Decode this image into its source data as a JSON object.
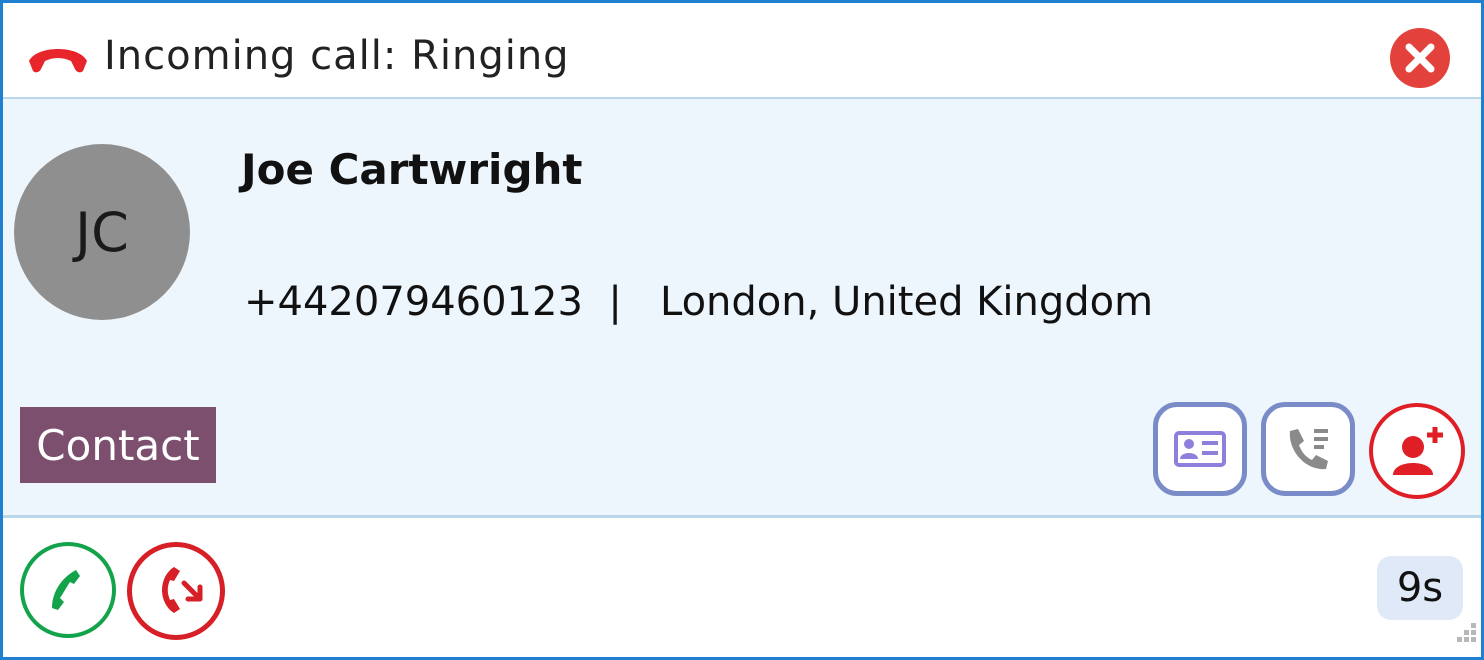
{
  "titlebar": {
    "status_text": "Incoming call: Ringing",
    "status_icon": "phone-hangup-icon",
    "close_icon": "close-icon",
    "colors": {
      "status_icon": "#e8252a",
      "close_button": "#e3413c"
    }
  },
  "caller": {
    "initials": "JC",
    "name": "Joe Cartwright",
    "phone": "+442079460123",
    "separator": "|",
    "location": "London, United Kingdom",
    "avatar_color": "#8f8f8f"
  },
  "contact_tag": {
    "label": "Contact",
    "color": "#7d4f6e"
  },
  "actions": [
    {
      "name": "contact-card-button",
      "icon": "contact-card-icon"
    },
    {
      "name": "call-history-button",
      "icon": "call-history-icon"
    },
    {
      "name": "add-contact-button",
      "icon": "add-contact-icon"
    }
  ],
  "footer": {
    "answer_icon": "phone-answer-icon",
    "reject_icon": "call-reject-icon",
    "timer": "9s",
    "colors": {
      "answer": "#13a34a",
      "reject": "#d61f26"
    }
  }
}
